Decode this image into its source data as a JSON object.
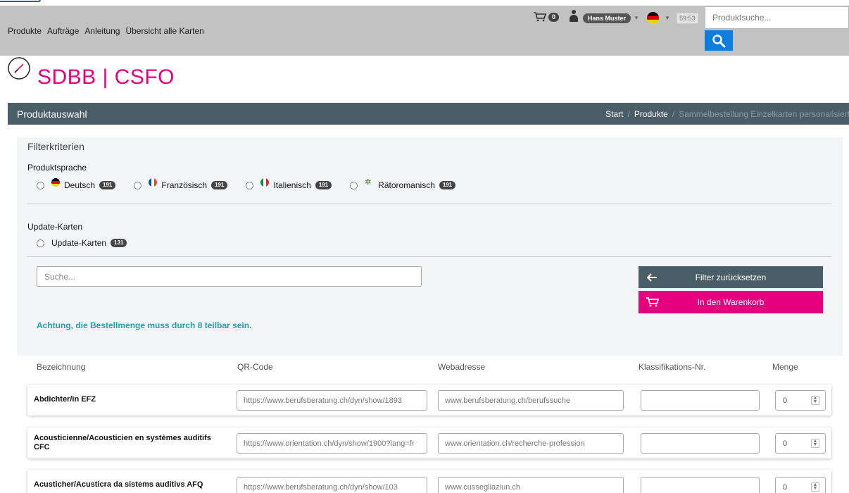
{
  "topnav": {
    "items": [
      "Produkte",
      "Aufträge",
      "Anleitung",
      "Übersicht alle Karten"
    ]
  },
  "topbar": {
    "cart_count": "0",
    "user_name": "Hans Muster",
    "timer": "59:53",
    "search_placeholder": "Produktsuche..."
  },
  "logo": {
    "text": "SDBB | CSFO"
  },
  "header": {
    "title": "Produktauswahl",
    "breadcrumb": [
      "Start",
      "Produkte",
      "Sammelbestellung Einzelkarten personalisiert"
    ]
  },
  "filters": {
    "title": "Filterkriterien",
    "language_label": "Produktsprache",
    "languages": [
      {
        "label": "Deutsch",
        "count": "191"
      },
      {
        "label": "Französisch",
        "count": "191"
      },
      {
        "label": "Italienisch",
        "count": "191"
      },
      {
        "label": "Rätoromanisch",
        "count": "191"
      }
    ],
    "update_label": "Update-Karten",
    "update_option": {
      "label": "Update-Karten",
      "count": "131"
    }
  },
  "search": {
    "placeholder": "Suche..."
  },
  "buttons": {
    "reset": "Filter zurücksetzen",
    "cart": "In den Warenkorb"
  },
  "warning": "Achtung, die Bestellmenge muss durch 8 teilbar sein.",
  "table": {
    "columns": [
      "Bezeichnung",
      "QR-Code",
      "Webadresse",
      "Klassifikations-Nr.",
      "Menge"
    ],
    "rows": [
      {
        "name": "Abdichter/in EFZ",
        "qr": "https://www.berufsberatung.ch/dyn/show/1893",
        "web": "www.berufsberatung.ch/berufssuche",
        "klass": "",
        "qty": "0"
      },
      {
        "name": "Acousticienne/Acousticien en systèmes auditifs CFC",
        "qr": "https://www.orientation.ch/dyn/show/1900?lang=fr",
        "web": "www.orientation.ch/recherche-profession",
        "klass": "",
        "qty": "0"
      },
      {
        "name": "Acusticher/Acusticra da sistems auditivs AFQ",
        "qr": "https://www.berufsberatung.ch/dyn/show/103",
        "web": "www.cussegliaziun.ch",
        "klass": "",
        "qty": "0"
      }
    ]
  },
  "colors": {
    "topbar": "#c2c2c2",
    "header": "#4a5e68",
    "accent_pink": "#e6007e",
    "search_blue": "#0d7de0",
    "warning_teal": "#24a0b4"
  }
}
